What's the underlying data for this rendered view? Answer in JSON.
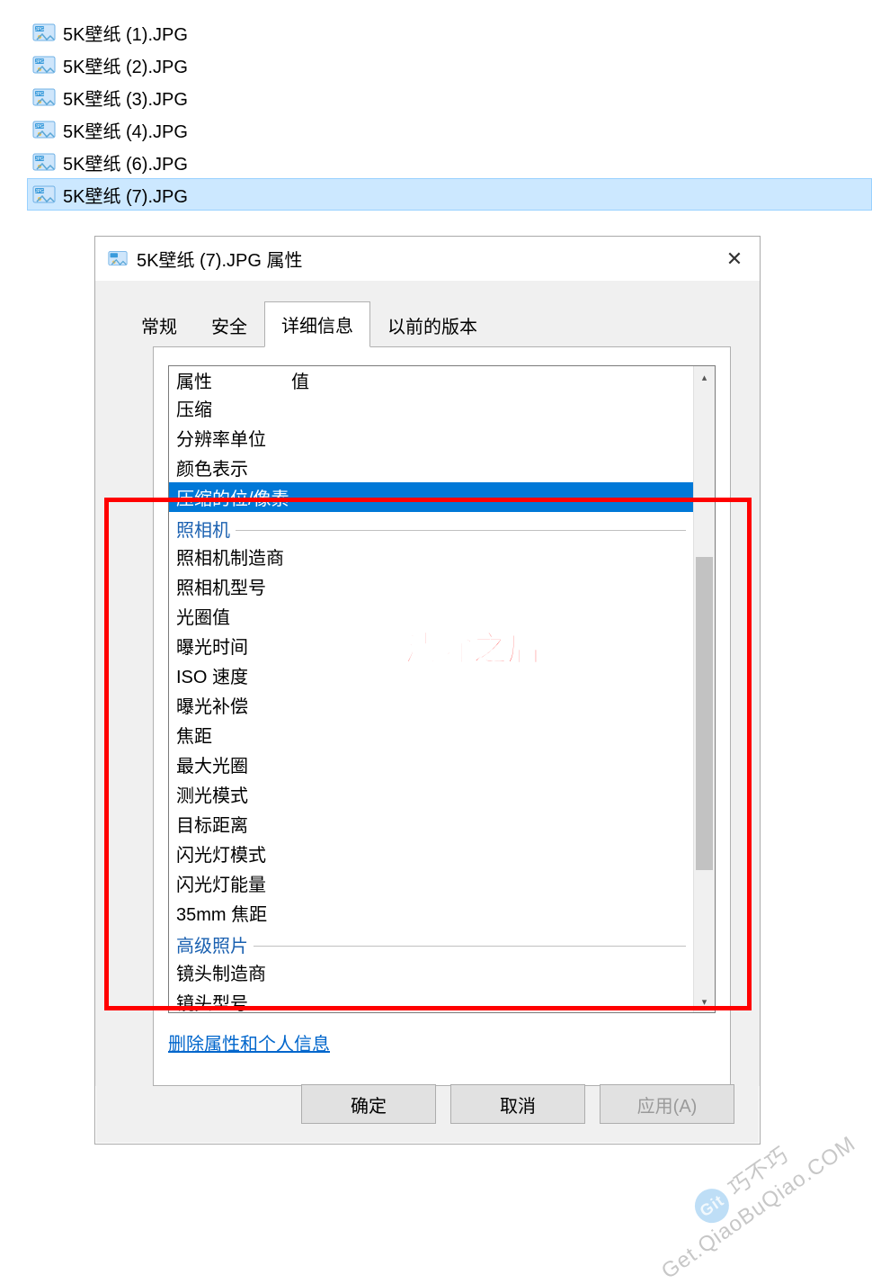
{
  "files": [
    {
      "name": "5K壁纸 (1).JPG",
      "selected": false
    },
    {
      "name": "5K壁纸 (2).JPG",
      "selected": false
    },
    {
      "name": "5K壁纸 (3).JPG",
      "selected": false
    },
    {
      "name": "5K壁纸 (4).JPG",
      "selected": false
    },
    {
      "name": "5K壁纸 (6).JPG",
      "selected": false
    },
    {
      "name": "5K壁纸 (7).JPG",
      "selected": true
    }
  ],
  "dialog": {
    "title": "5K壁纸 (7).JPG 属性",
    "tabs": {
      "general": "常规",
      "security": "安全",
      "details": "详细信息",
      "previous": "以前的版本",
      "active": "details"
    },
    "headers": {
      "property": "属性",
      "value": "值"
    },
    "rows_top": [
      "压缩",
      "分辨率单位",
      "颜色表示"
    ],
    "row_selected": "压缩的位/像素",
    "section_camera": "照相机",
    "rows_camera": [
      "照相机制造商",
      "照相机型号",
      "光圈值",
      "曝光时间",
      "ISO 速度",
      "曝光补偿",
      "焦距",
      "最大光圈",
      "测光模式",
      "目标距离",
      "闪光灯模式",
      "闪光灯能量",
      "35mm 焦距"
    ],
    "section_advanced": "高级照片",
    "rows_advanced": [
      "镜头制造商",
      "镜头型号"
    ],
    "link": "删除属性和个人信息",
    "buttons": {
      "ok": "确定",
      "cancel": "取消",
      "apply": "应用(A)"
    }
  },
  "annotation": {
    "label": "清除之后"
  },
  "watermark": {
    "line1": "巧不巧",
    "line2": "Get.QiaoBuQiao.COM",
    "badge": "Git"
  }
}
